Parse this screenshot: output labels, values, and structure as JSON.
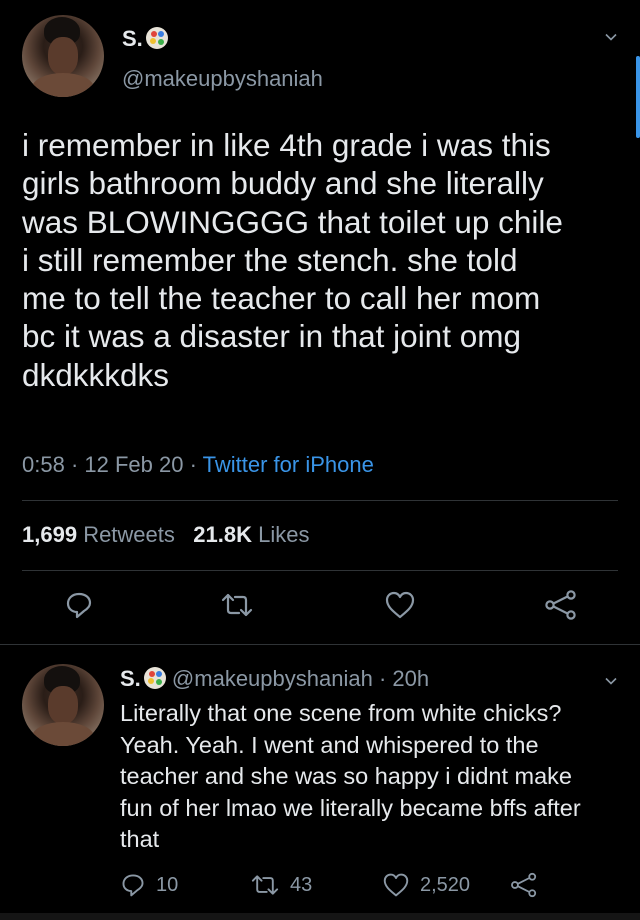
{
  "main_tweet": {
    "display_name": "S.",
    "handle": "@makeupbyshaniah",
    "text_lines": [
      "i remember in like 4th grade i was this",
      "girls bathroom buddy and she literally",
      "was BLOWINGGGG that toilet up chile",
      "i still remember the stench. she told",
      "me to tell the teacher to call her mom",
      "bc it was a disaster in that joint omg",
      "dkdkkkdks"
    ],
    "time": "0:58",
    "date": "12 Feb 20",
    "source": "Twitter for iPhone",
    "separator": "·",
    "retweets_count": "1,699",
    "retweets_label": "Retweets",
    "likes_count": "21.8K",
    "likes_label": "Likes"
  },
  "reply": {
    "display_name": "S.",
    "handle": "@makeupbyshaniah",
    "age": "20h",
    "separator": "·",
    "text_lines": [
      "Literally that one scene from white chicks?",
      "Yeah. Yeah. I went and whispered to the",
      "teacher and she was so happy i didnt make",
      "fun of her lmao we literally became bffs after",
      "that"
    ],
    "reply_count": "10",
    "retweet_count": "43",
    "like_count": "2,520"
  },
  "colors": {
    "background": "#000000",
    "text": "#e6e9ec",
    "muted": "#8b98a5",
    "link": "#3a95e8",
    "divider": "#2f3336"
  },
  "icons": [
    "reply-icon",
    "retweet-icon",
    "like-icon",
    "share-icon",
    "chevron-down-icon",
    "palette-emoji"
  ]
}
